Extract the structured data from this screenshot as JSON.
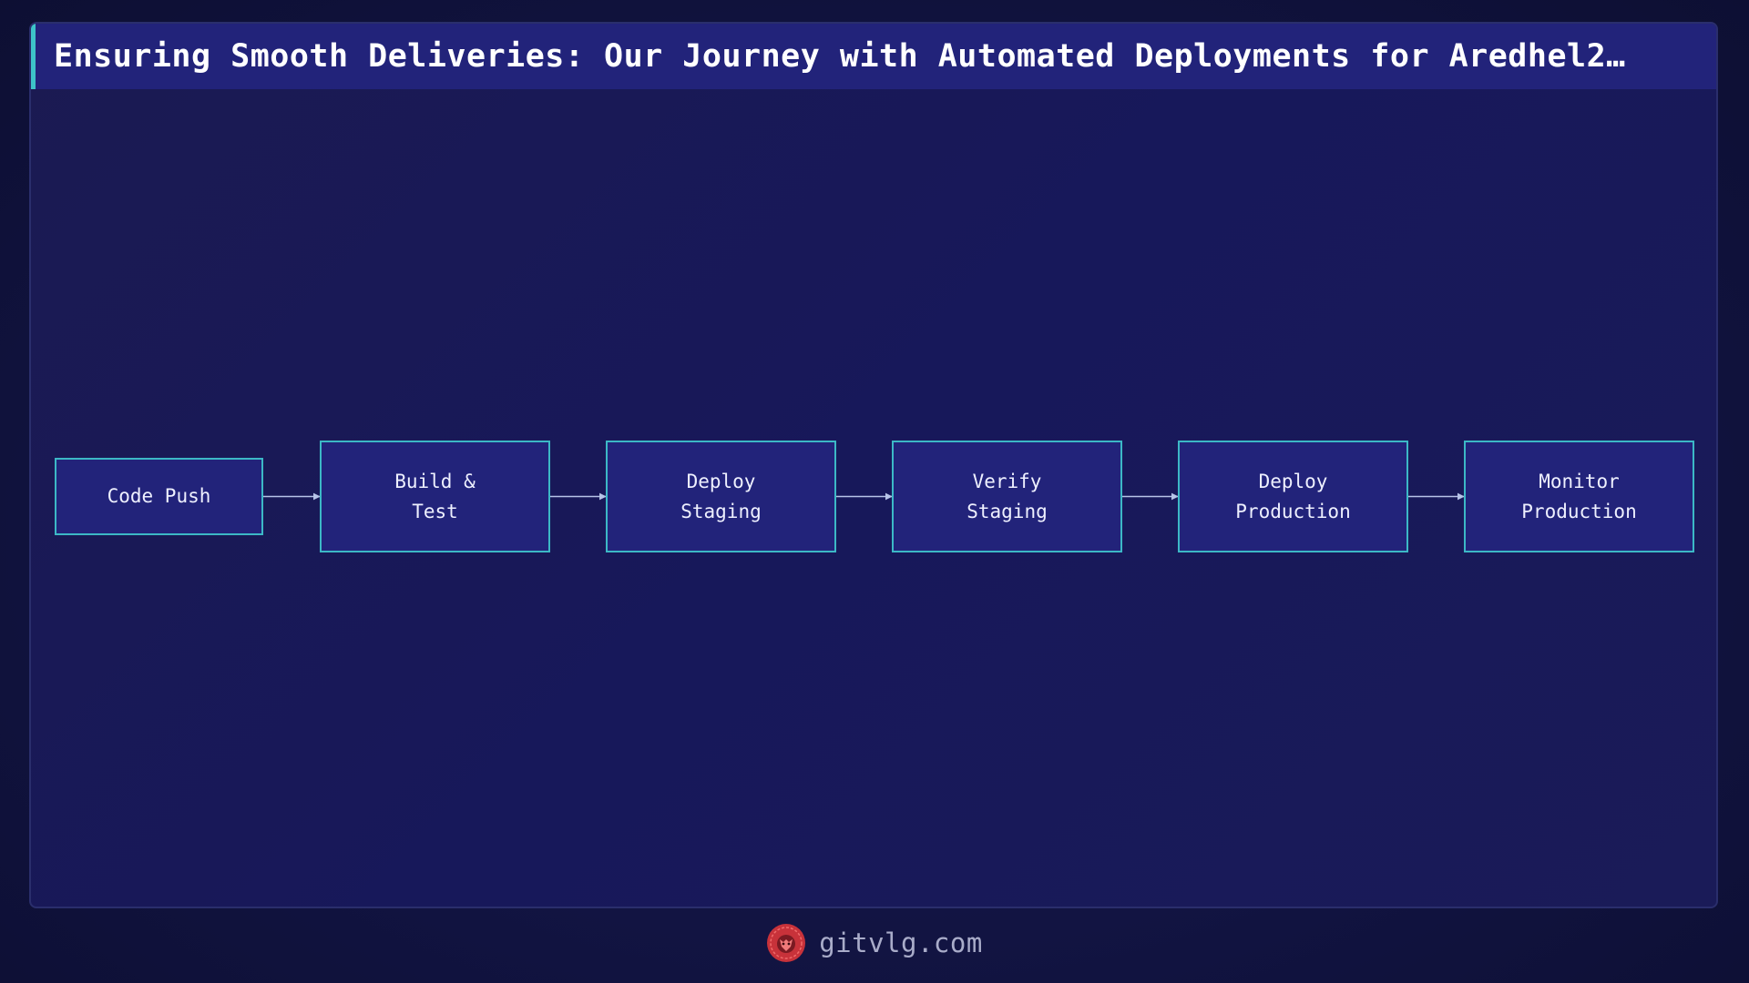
{
  "title": "Ensuring Smooth Deliveries: Our Journey with Automated Deployments for Aredhel2…",
  "colors": {
    "node_fill": "#22237a",
    "node_border": "#3cb8c6",
    "arrow": "#b7c4e8",
    "accent": "#3dc4c8",
    "logo": "#d23a3a"
  },
  "nodes": [
    {
      "id": "code-push",
      "label": "Code Push"
    },
    {
      "id": "build-test",
      "label": "Build &\nTest"
    },
    {
      "id": "deploy-staging",
      "label": "Deploy\nStaging"
    },
    {
      "id": "verify-staging",
      "label": "Verify\nStaging"
    },
    {
      "id": "deploy-production",
      "label": "Deploy\nProduction"
    },
    {
      "id": "monitor-production",
      "label": "Monitor\nProduction"
    }
  ],
  "edges": [
    {
      "from": "code-push",
      "to": "build-test"
    },
    {
      "from": "build-test",
      "to": "deploy-staging"
    },
    {
      "from": "deploy-staging",
      "to": "verify-staging"
    },
    {
      "from": "verify-staging",
      "to": "deploy-production"
    },
    {
      "from": "deploy-production",
      "to": "monitor-production"
    }
  ],
  "footer": {
    "logo_icon": "lion-head-icon",
    "site": "gitvlg.com"
  }
}
